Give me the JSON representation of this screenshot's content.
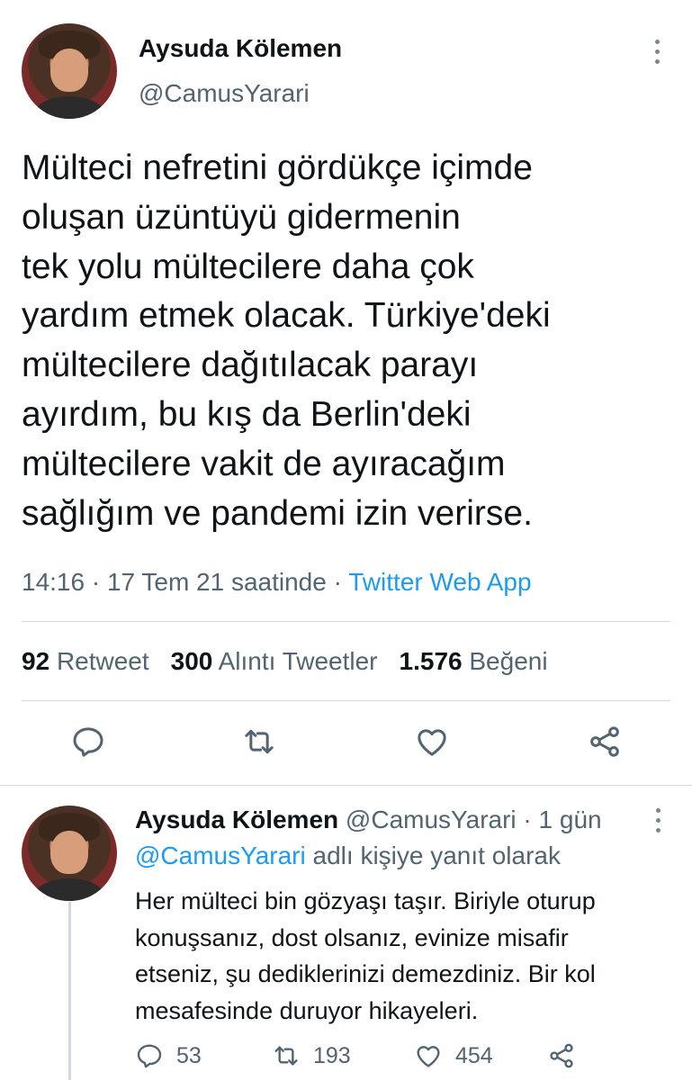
{
  "main_tweet": {
    "display_name": "Aysuda Kölemen",
    "handle": "@CamusYarari",
    "text": "Mülteci nefretini gördükçe içimde\noluşan üzüntüyü gidermenin\ntek yolu mültecilere daha çok\nyardım etmek olacak. Türkiye'deki\nmültecilere dağıtılacak parayı\nayırdım, bu kış da Berlin'deki\nmültecilere vakit de ayıracağım\nsağlığım ve pandemi izin verirse.",
    "timestamp": "14:16 · 17 Tem 21 saatinde · ",
    "source": "Twitter Web App",
    "stats": {
      "retweets_count": "92",
      "retweets_label": "Retweet",
      "quotes_count": "300",
      "quotes_label": "Alıntı Tweetler",
      "likes_count": "1.576",
      "likes_label": "Beğeni"
    }
  },
  "reply_tweet": {
    "display_name": "Aysuda Kölemen",
    "handle_time": " @CamusYarari · 1 gün",
    "replying_to_mention": "@CamusYarari",
    "replying_to_suffix": " adlı kişiye yanıt olarak",
    "text": "Her mülteci bin gözyaşı taşır. Biriyle oturup\nkonuşsanız, dost olsanız, evinize misafir\netseniz, şu dediklerinizi demezdiniz. Bir kol\nmesafesinde duruyor hikayeleri.",
    "counts": {
      "replies": "53",
      "retweets": "193",
      "likes": "454"
    }
  },
  "colors": {
    "text": "#0f1419",
    "secondary": "#536471",
    "accent": "#1d9bf0",
    "divider": "#cfd9de"
  },
  "icons": [
    "more-vertical-icon",
    "reply-icon",
    "retweet-icon",
    "like-icon",
    "share-icon"
  ]
}
